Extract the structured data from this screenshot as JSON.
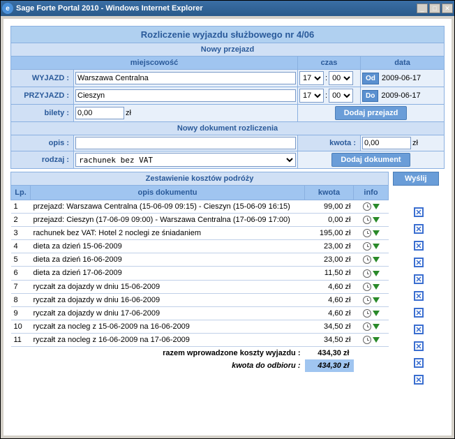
{
  "window": {
    "title": "Sage Forte Portal 2010 - Windows Internet Explorer",
    "icon": "e"
  },
  "header": {
    "main": "Rozliczenie wyjazdu służbowego nr 4/06",
    "travel_section": "Nowy przejazd",
    "cols": {
      "miejsce": "miejscowość",
      "czas": "czas",
      "data": "data"
    },
    "wyjazd_label": "WYJAZD :",
    "przyjazd_label": "PRZYJAZD :",
    "bilety_label": "bilety :",
    "btn_od": "Od",
    "btn_do": "Do",
    "btn_add_travel": "Dodaj przejazd",
    "wyjazd": {
      "place": "Warszawa Centralna",
      "h": "17",
      "m": "00",
      "date": "2009-06-17"
    },
    "przyjazd": {
      "place": "Cieszyn",
      "h": "17",
      "m": "00",
      "date": "2009-06-17"
    },
    "bilety_value": "0,00",
    "bilety_unit": "zł"
  },
  "doc": {
    "section": "Nowy dokument rozliczenia",
    "opis_label": "opis :",
    "kwota_label": "kwota :",
    "rodzaj_label": "rodzaj :",
    "opis_value": "",
    "kwota_value": "0,00",
    "kwota_unit": "zł",
    "rodzaj_value": "rachunek bez VAT",
    "btn_add_doc": "Dodaj dokument"
  },
  "btn_send": "Wyślij",
  "list": {
    "title": "Zestawienie kosztów podróży",
    "cols": {
      "lp": "Lp.",
      "opis": "opis dokumentu",
      "kwota": "kwota",
      "info": "info"
    },
    "rows": [
      {
        "lp": "1",
        "opis": "przejazd: Warszawa Centralna (15-06-09 09:15) - Cieszyn (15-06-09 16:15)",
        "kwota": "99,00 zł"
      },
      {
        "lp": "2",
        "opis": "przejazd: Cieszyn (17-06-09 09:00) - Warszawa Centralna (17-06-09 17:00)",
        "kwota": "0,00 zł"
      },
      {
        "lp": "3",
        "opis": "rachunek bez VAT: Hotel 2 noclegi ze śniadaniem",
        "kwota": "195,00 zł"
      },
      {
        "lp": "4",
        "opis": "dieta za dzień 15-06-2009",
        "kwota": "23,00 zł"
      },
      {
        "lp": "5",
        "opis": "dieta za dzień 16-06-2009",
        "kwota": "23,00 zł"
      },
      {
        "lp": "6",
        "opis": "dieta za dzień 17-06-2009",
        "kwota": "11,50 zł"
      },
      {
        "lp": "7",
        "opis": "ryczałt za dojazdy w dniu 15-06-2009",
        "kwota": "4,60 zł"
      },
      {
        "lp": "8",
        "opis": "ryczałt za dojazdy w dniu 16-06-2009",
        "kwota": "4,60 zł"
      },
      {
        "lp": "9",
        "opis": "ryczałt za dojazdy w dniu 17-06-2009",
        "kwota": "4,60 zł"
      },
      {
        "lp": "10",
        "opis": "ryczałt za nocleg z 15-06-2009 na 16-06-2009",
        "kwota": "34,50 zł"
      },
      {
        "lp": "11",
        "opis": "ryczałt za nocleg z 16-06-2009 na 17-06-2009",
        "kwota": "34,50 zł"
      }
    ]
  },
  "totals": {
    "razem_label": "razem wprowadzone koszty wyjazdu :",
    "razem_value": "434,30 zł",
    "odbior_label": "kwota do odbioru :",
    "odbior_value": "434,30 zł"
  }
}
